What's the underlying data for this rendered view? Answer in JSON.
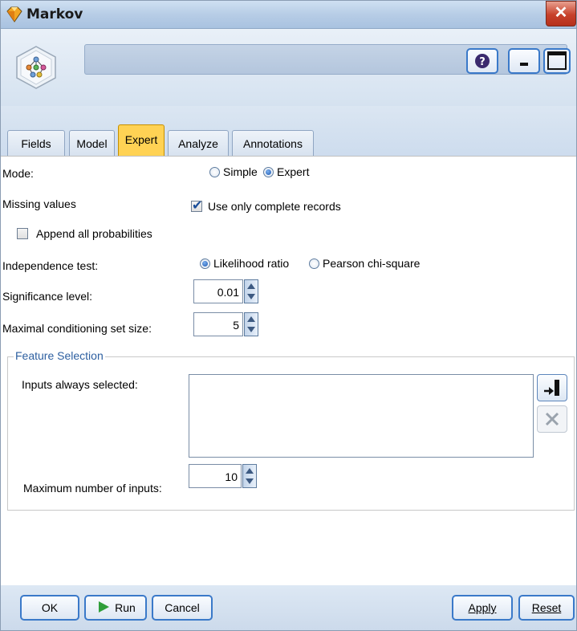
{
  "window": {
    "title": "Markov",
    "close_glyph": "✕"
  },
  "header": {
    "node_name": ""
  },
  "tabs": [
    {
      "label": "Fields"
    },
    {
      "label": "Model"
    },
    {
      "label": "Expert",
      "active": true
    },
    {
      "label": "Analyze"
    },
    {
      "label": "Annotations"
    }
  ],
  "expert": {
    "mode_label": "Mode:",
    "mode_options": [
      "Simple",
      "Expert"
    ],
    "mode_selected": "Expert",
    "missing_label": "Missing values",
    "complete_records_label": "Use only complete records",
    "complete_records_checked": true,
    "append_label": "Append all probabilities",
    "append_checked": false,
    "independence_label": "Independence test:",
    "independence_options": [
      "Likelihood ratio",
      "Pearson chi-square"
    ],
    "independence_selected": "Likelihood ratio",
    "significance_label": "Significance level:",
    "significance_value": "0.01",
    "conditioning_label": "Maximal conditioning set size:",
    "conditioning_value": "5"
  },
  "feature_selection": {
    "legend": "Feature Selection",
    "inputs_label": "Inputs always selected:",
    "max_inputs_label": "Maximum number of inputs:",
    "max_inputs_value": "10"
  },
  "footer": {
    "ok": "OK",
    "run": "Run",
    "cancel": "Cancel",
    "apply": "Apply",
    "reset": "Reset"
  },
  "icons": {
    "title": "diamond-node-icon",
    "node": "bayes-network-node-icon",
    "help": "help-icon",
    "minimize": "minimize-icon",
    "maximize": "maximize-icon",
    "pick_fields": "field-picker-icon",
    "delete": "delete-icon",
    "run": "play-icon"
  },
  "colors": {
    "active_tab": "#ffd254",
    "legend_text": "#2d5fa0",
    "button_border": "#3a79c9",
    "run_green": "#2f9e3a"
  }
}
